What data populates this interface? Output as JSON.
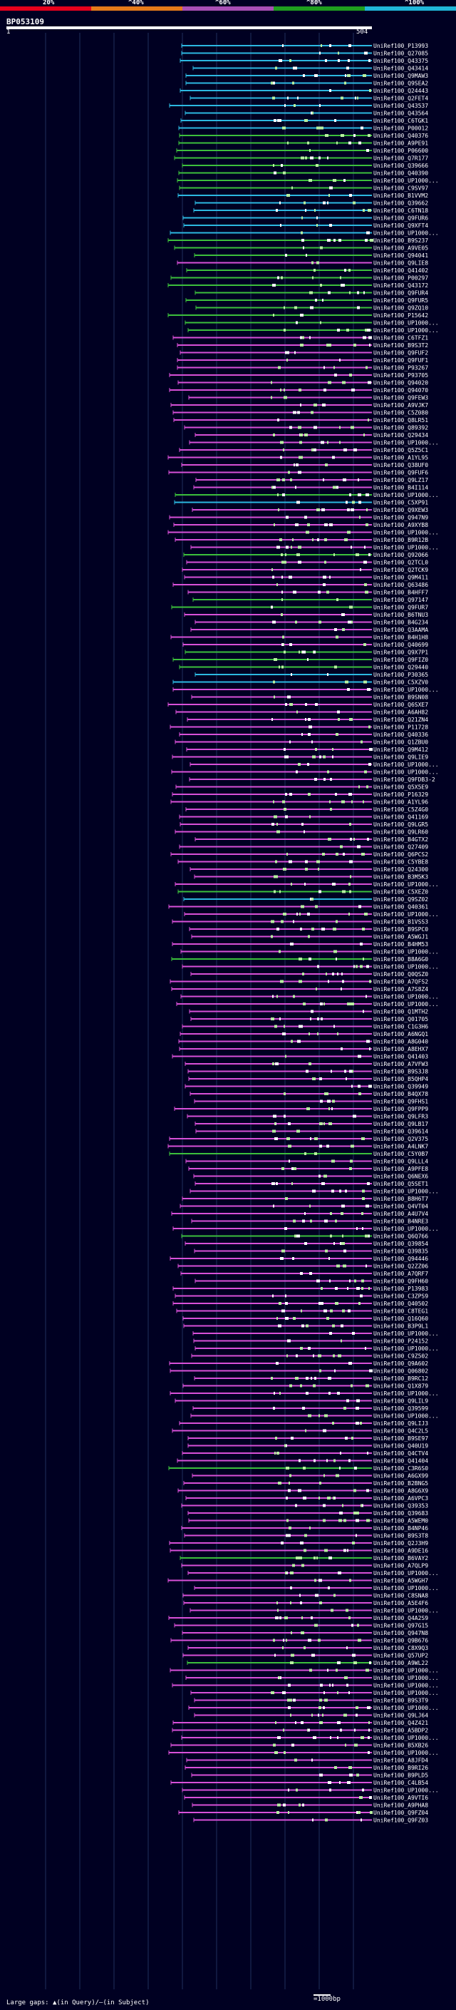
{
  "legend": {
    "labels": [
      "20%",
      "^40%",
      "^60%",
      "^80%",
      "^100%"
    ],
    "colors": [
      "#e8001c",
      "#e67a1a",
      "#a94fb5",
      "#1f9e1f",
      "#20b6d8"
    ]
  },
  "query": {
    "name": "BP053109",
    "start": "1",
    "end": "504"
  },
  "colors": {
    "background": "#000022",
    "grid": "#1f2f5c",
    "pink": "#d850d8",
    "green": "#3cbf3c",
    "cyan": "#2cb8e0",
    "light_green": "#b8f0a0",
    "white": "#ffffff"
  },
  "hits": [
    {
      "id": "UniRef100_P13993",
      "color": "cyan"
    },
    {
      "id": "UniRef100_Q27085",
      "color": "cyan"
    },
    {
      "id": "UniRef100_Q43375",
      "color": "cyan"
    },
    {
      "id": "UniRef100_Q43414",
      "color": "cyan"
    },
    {
      "id": "UniRef100_Q9MAW3",
      "color": "cyan"
    },
    {
      "id": "UniRef100_Q9SEA2",
      "color": "cyan"
    },
    {
      "id": "UniRef100_Q24443",
      "color": "cyan"
    },
    {
      "id": "UniRef100_Q2FET4",
      "color": "cyan"
    },
    {
      "id": "UniRef100_Q43537",
      "color": "cyan"
    },
    {
      "id": "UniRef100_Q43564",
      "color": "cyan"
    },
    {
      "id": "UniRef100_C6TGK1",
      "color": "cyan"
    },
    {
      "id": "UniRef100_P00012",
      "color": "cyan"
    },
    {
      "id": "UniRef100_Q40376",
      "color": "green"
    },
    {
      "id": "UniRef100_A9PE91",
      "color": "green"
    },
    {
      "id": "UniRef100_P06600",
      "color": "green"
    },
    {
      "id": "UniRef100_Q7R177",
      "color": "green"
    },
    {
      "id": "UniRef100_Q39666",
      "color": "green"
    },
    {
      "id": "UniRef100_Q40390",
      "color": "green"
    },
    {
      "id": "UniRef100_UP1000...",
      "color": "green"
    },
    {
      "id": "UniRef100_C9SV97",
      "color": "green"
    },
    {
      "id": "UniRef100_B1VVM2",
      "color": "cyan"
    },
    {
      "id": "UniRef100_Q39662",
      "color": "cyan"
    },
    {
      "id": "UniRef100_C6TN18",
      "color": "cyan"
    },
    {
      "id": "UniRef100_Q9FUR6",
      "color": "cyan"
    },
    {
      "id": "UniRef100_Q9XFT4",
      "color": "cyan"
    },
    {
      "id": "UniRef100_UP1000...",
      "color": "cyan"
    },
    {
      "id": "UniRef100_B9S237",
      "color": "green"
    },
    {
      "id": "UniRef100_A9VE05",
      "color": "green"
    },
    {
      "id": "UniRef100_Q94041",
      "color": "green"
    },
    {
      "id": "UniRef100_Q9LIE8",
      "color": "pink"
    },
    {
      "id": "UniRef100_Q41402",
      "color": "green"
    },
    {
      "id": "UniRef100_P00297",
      "color": "green"
    },
    {
      "id": "UniRef100_Q43172",
      "color": "green"
    },
    {
      "id": "UniRef100_Q9FUR4",
      "color": "green"
    },
    {
      "id": "UniRef100_Q9FUR5",
      "color": "green"
    },
    {
      "id": "UniRef100_Q9ZQ10",
      "color": "green"
    },
    {
      "id": "UniRef100_P15642",
      "color": "green"
    },
    {
      "id": "UniRef100_UP1000...",
      "color": "green"
    },
    {
      "id": "UniRef100_UP1000...",
      "color": "green"
    },
    {
      "id": "UniRef100_C6TFZ1",
      "color": "pink"
    },
    {
      "id": "UniRef100_B9S3T2",
      "color": "pink"
    },
    {
      "id": "UniRef100_Q9FUF2",
      "color": "pink"
    },
    {
      "id": "UniRef100_Q9FUF1",
      "color": "pink"
    },
    {
      "id": "UniRef100_P93267",
      "color": "pink"
    },
    {
      "id": "UniRef100_P93705",
      "color": "pink"
    },
    {
      "id": "UniRef100_Q94020",
      "color": "pink"
    },
    {
      "id": "UniRef100_Q94070",
      "color": "pink"
    },
    {
      "id": "UniRef100_Q9FEW3",
      "color": "pink"
    },
    {
      "id": "UniRef100_A9VJK7",
      "color": "pink"
    },
    {
      "id": "UniRef100_C5Z080",
      "color": "pink"
    },
    {
      "id": "UniRef100_Q8LR51",
      "color": "pink"
    },
    {
      "id": "UniRef100_Q89392",
      "color": "pink"
    },
    {
      "id": "UniRef100_Q29434",
      "color": "pink"
    },
    {
      "id": "UniRef100_UP1000...",
      "color": "pink"
    },
    {
      "id": "UniRef100_Q5Z5C1",
      "color": "pink"
    },
    {
      "id": "UniRef100_A1YL95",
      "color": "pink"
    },
    {
      "id": "UniRef100_Q38UF0",
      "color": "pink"
    },
    {
      "id": "UniRef100_Q9FUF6",
      "color": "pink"
    },
    {
      "id": "UniRef100_Q9LZ17",
      "color": "pink"
    },
    {
      "id": "UniRef100_B4I114",
      "color": "pink"
    },
    {
      "id": "UniRef100_UP1000...",
      "color": "green"
    },
    {
      "id": "UniRef100_C5XP91",
      "color": "cyan"
    },
    {
      "id": "UniRef100_Q9XEW3",
      "color": "pink"
    },
    {
      "id": "UniRef100_Q947N9",
      "color": "pink"
    },
    {
      "id": "UniRef100_A9XYB8",
      "color": "pink"
    },
    {
      "id": "UniRef100_UP1000...",
      "color": "pink"
    },
    {
      "id": "UniRef100_B9R12B",
      "color": "pink"
    },
    {
      "id": "UniRef100_UP1000...",
      "color": "pink"
    },
    {
      "id": "UniRef100_Q92066",
      "color": "green"
    },
    {
      "id": "UniRef100_Q2TCL0",
      "color": "pink"
    },
    {
      "id": "UniRef100_Q2TCK9",
      "color": "pink"
    },
    {
      "id": "UniRef100_Q9M411",
      "color": "pink"
    },
    {
      "id": "UniRef100_Q63486",
      "color": "pink"
    },
    {
      "id": "UniRef100_B4HFF7",
      "color": "pink"
    },
    {
      "id": "UniRef100_Q97147",
      "color": "green"
    },
    {
      "id": "UniRef100_Q9FUR7",
      "color": "green"
    },
    {
      "id": "UniRef100_B6TNU3",
      "color": "pink"
    },
    {
      "id": "UniRef100_B4G234",
      "color": "pink"
    },
    {
      "id": "UniRef100_Q3AAMA",
      "color": "pink"
    },
    {
      "id": "UniRef100_B4H1H8",
      "color": "pink"
    },
    {
      "id": "UniRef100_Q40699",
      "color": "pink"
    },
    {
      "id": "UniRef100_Q9X7P1",
      "color": "green"
    },
    {
      "id": "UniRef100_Q9FIZ0",
      "color": "green"
    },
    {
      "id": "UniRef100_Q29440",
      "color": "green"
    },
    {
      "id": "UniRef100_P30365",
      "color": "cyan"
    },
    {
      "id": "UniRef100_C5XZV0",
      "color": "cyan"
    },
    {
      "id": "UniRef100_UP1000...",
      "color": "pink"
    },
    {
      "id": "UniRef100_B9SN08",
      "color": "pink"
    },
    {
      "id": "UniRef100_Q6SXE7",
      "color": "pink"
    },
    {
      "id": "UniRef100_A6AH82",
      "color": "pink"
    },
    {
      "id": "UniRef100_Q21ZN4",
      "color": "pink"
    },
    {
      "id": "UniRef100_P11728",
      "color": "pink"
    },
    {
      "id": "UniRef100_Q40336",
      "color": "pink"
    },
    {
      "id": "UniRef100_Q1ZBU0",
      "color": "pink"
    },
    {
      "id": "UniRef100_Q9M412",
      "color": "pink"
    },
    {
      "id": "UniRef100_Q9LIE9",
      "color": "pink"
    },
    {
      "id": "UniRef100_UP1000...",
      "color": "pink"
    },
    {
      "id": "UniRef100_UP1000...",
      "color": "pink"
    },
    {
      "id": "UniRef100_Q9FDB3-2",
      "color": "pink"
    },
    {
      "id": "UniRef100_Q5X5E9",
      "color": "pink"
    },
    {
      "id": "UniRef100_P16329",
      "color": "pink"
    },
    {
      "id": "UniRef100_A1YL96",
      "color": "pink"
    },
    {
      "id": "UniRef100_C5Z4G0",
      "color": "pink"
    },
    {
      "id": "UniRef100_Q41169",
      "color": "pink"
    },
    {
      "id": "UniRef100_Q9LGR5",
      "color": "pink"
    },
    {
      "id": "UniRef100_Q9LR60",
      "color": "pink"
    },
    {
      "id": "UniRef100_B4GTX2",
      "color": "pink"
    },
    {
      "id": "UniRef100_Q27409",
      "color": "pink"
    },
    {
      "id": "UniRef100_Q6PCS2",
      "color": "pink"
    },
    {
      "id": "UniRef100_C5YBE8",
      "color": "pink"
    },
    {
      "id": "UniRef100_Q24300",
      "color": "pink"
    },
    {
      "id": "UniRef100_B3M5K3",
      "color": "pink"
    },
    {
      "id": "UniRef100_UP1000...",
      "color": "pink"
    },
    {
      "id": "UniRef100_C5XEZ0",
      "color": "green"
    },
    {
      "id": "UniRef100_Q9SZ02",
      "color": "cyan"
    },
    {
      "id": "UniRef100_Q40361",
      "color": "pink"
    },
    {
      "id": "UniRef100_UP1000...",
      "color": "pink"
    },
    {
      "id": "UniRef100_B1VSS3",
      "color": "pink"
    },
    {
      "id": "UniRef100_B9SPC0",
      "color": "pink"
    },
    {
      "id": "UniRef100_A5WGJ1",
      "color": "pink"
    },
    {
      "id": "UniRef100_B4HM53",
      "color": "pink"
    },
    {
      "id": "UniRef100_UP1000...",
      "color": "pink"
    },
    {
      "id": "UniRef100_B8A6G0",
      "color": "green"
    },
    {
      "id": "UniRef100_UP1000...",
      "color": "pink"
    },
    {
      "id": "UniRef100_Q0QSZ0",
      "color": "pink"
    },
    {
      "id": "UniRef100_A7QFS2",
      "color": "pink"
    },
    {
      "id": "UniRef100_A7S8Z4",
      "color": "pink"
    },
    {
      "id": "UniRef100_UP1000...",
      "color": "pink"
    },
    {
      "id": "UniRef100_UP1000...",
      "color": "pink"
    },
    {
      "id": "UniRef100_Q1MTH2",
      "color": "pink"
    },
    {
      "id": "UniRef100_Q01705",
      "color": "pink"
    },
    {
      "id": "UniRef100_C1G3H6",
      "color": "pink"
    },
    {
      "id": "UniRef100_A6NGQ1",
      "color": "pink"
    },
    {
      "id": "UniRef100_A8G040",
      "color": "pink"
    },
    {
      "id": "UniRef100_A8EHX7",
      "color": "pink"
    },
    {
      "id": "UniRef100_Q41403",
      "color": "pink"
    },
    {
      "id": "UniRef100_A7VFW3",
      "color": "pink"
    },
    {
      "id": "UniRef100_B9S3J8",
      "color": "pink"
    },
    {
      "id": "UniRef100_B5QHP4",
      "color": "pink"
    },
    {
      "id": "UniRef100_Q39949",
      "color": "pink"
    },
    {
      "id": "UniRef100_B4QX78",
      "color": "pink"
    },
    {
      "id": "UniRef100_Q9FHS1",
      "color": "pink"
    },
    {
      "id": "UniRef100_Q9FPP9",
      "color": "pink"
    },
    {
      "id": "UniRef100_Q9LFR3",
      "color": "pink"
    },
    {
      "id": "UniRef100_Q9LB17",
      "color": "pink"
    },
    {
      "id": "UniRef100_Q39614",
      "color": "pink"
    },
    {
      "id": "UniRef100_Q2V375",
      "color": "pink"
    },
    {
      "id": "UniRef100_A4LNK7",
      "color": "pink"
    },
    {
      "id": "UniRef100_C5Y0B7",
      "color": "green"
    },
    {
      "id": "UniRef100_Q9LLL4",
      "color": "pink"
    },
    {
      "id": "UniRef100_A9PFE8",
      "color": "pink"
    },
    {
      "id": "UniRef100_Q6NEX6",
      "color": "pink"
    },
    {
      "id": "UniRef100_Q5SET1",
      "color": "pink"
    },
    {
      "id": "UniRef100_UP1000...",
      "color": "pink"
    },
    {
      "id": "UniRef100_B8H6T7",
      "color": "pink"
    },
    {
      "id": "UniRef100_Q4VT04",
      "color": "pink"
    },
    {
      "id": "UniRef100_A4U7V4",
      "color": "pink"
    },
    {
      "id": "UniRef100_B4NRE3",
      "color": "pink"
    },
    {
      "id": "UniRef100_UP1000...",
      "color": "pink"
    },
    {
      "id": "UniRef100_Q6Q766",
      "color": "green"
    },
    {
      "id": "UniRef100_Q39854",
      "color": "pink"
    },
    {
      "id": "UniRef100_Q39835",
      "color": "pink"
    },
    {
      "id": "UniRef100_Q94446",
      "color": "pink"
    },
    {
      "id": "UniRef100_Q2ZZ06",
      "color": "pink"
    },
    {
      "id": "UniRef100_A7QRF7",
      "color": "pink"
    },
    {
      "id": "UniRef100_Q9FH60",
      "color": "pink"
    },
    {
      "id": "UniRef100_P13983",
      "color": "pink"
    },
    {
      "id": "UniRef100_C3ZPS9",
      "color": "pink"
    },
    {
      "id": "UniRef100_Q40502",
      "color": "pink"
    },
    {
      "id": "UniRef100_C8TEG1",
      "color": "pink"
    },
    {
      "id": "UniRef100_Q16Q60",
      "color": "pink"
    },
    {
      "id": "UniRef100_B3P9L1",
      "color": "pink"
    },
    {
      "id": "UniRef100_UP1000...",
      "color": "pink"
    },
    {
      "id": "UniRef100_P24152",
      "color": "pink"
    },
    {
      "id": "UniRef100_UP1000...",
      "color": "pink"
    },
    {
      "id": "UniRef100_C9Z502",
      "color": "pink"
    },
    {
      "id": "UniRef100_Q9A602",
      "color": "pink"
    },
    {
      "id": "UniRef100_Q06802",
      "color": "pink"
    },
    {
      "id": "UniRef100_B9RC12",
      "color": "pink"
    },
    {
      "id": "UniRef100_Q1X879",
      "color": "pink"
    },
    {
      "id": "UniRef100_UP1000...",
      "color": "pink"
    },
    {
      "id": "UniRef100_Q9LIL9",
      "color": "pink"
    },
    {
      "id": "UniRef100_Q39599",
      "color": "pink"
    },
    {
      "id": "UniRef100_UP1000...",
      "color": "pink"
    },
    {
      "id": "UniRef100_Q9LIJ3",
      "color": "pink"
    },
    {
      "id": "UniRef100_Q4C2L5",
      "color": "pink"
    },
    {
      "id": "UniRef100_B9SE97",
      "color": "pink"
    },
    {
      "id": "UniRef100_Q40U19",
      "color": "pink"
    },
    {
      "id": "UniRef100_Q4CTV4",
      "color": "pink"
    },
    {
      "id": "UniRef100_Q41404",
      "color": "pink"
    },
    {
      "id": "UniRef100_C3R6S0",
      "color": "green"
    },
    {
      "id": "UniRef100_A6GX99",
      "color": "pink"
    },
    {
      "id": "UniRef100_B2BNG5",
      "color": "pink"
    },
    {
      "id": "UniRef100_A8G6X9",
      "color": "pink"
    },
    {
      "id": "UniRef100_A6VPC3",
      "color": "pink"
    },
    {
      "id": "UniRef100_Q39353",
      "color": "pink"
    },
    {
      "id": "UniRef100_Q39683",
      "color": "pink"
    },
    {
      "id": "UniRef100_A5WEM0",
      "color": "pink"
    },
    {
      "id": "UniRef100_B4NP46",
      "color": "pink"
    },
    {
      "id": "UniRef100_B9S3T8",
      "color": "pink"
    },
    {
      "id": "UniRef100_Q2J3H9",
      "color": "pink"
    },
    {
      "id": "UniRef100_A9DE16",
      "color": "pink"
    },
    {
      "id": "UniRef100_B6VAY2",
      "color": "green"
    },
    {
      "id": "UniRef100_A7QLP9",
      "color": "pink"
    },
    {
      "id": "UniRef100_UP1000...",
      "color": "pink"
    },
    {
      "id": "UniRef100_A5WGH7",
      "color": "pink"
    },
    {
      "id": "UniRef100_UP1000...",
      "color": "pink"
    },
    {
      "id": "UniRef100_C8SNA8",
      "color": "pink"
    },
    {
      "id": "UniRef100_A5E4F6",
      "color": "pink"
    },
    {
      "id": "UniRef100_UP1000...",
      "color": "pink"
    },
    {
      "id": "UniRef100_Q4A2S9",
      "color": "pink"
    },
    {
      "id": "UniRef100_Q97G15",
      "color": "pink"
    },
    {
      "id": "UniRef100_Q947N8",
      "color": "pink"
    },
    {
      "id": "UniRef100_Q9B676",
      "color": "pink"
    },
    {
      "id": "UniRef100_C8X9Q3",
      "color": "pink"
    },
    {
      "id": "UniRef100_Q57UP2",
      "color": "pink"
    },
    {
      "id": "UniRef100_A9WL22",
      "color": "green"
    },
    {
      "id": "UniRef100_UP1000...",
      "color": "pink"
    },
    {
      "id": "UniRef100_UP1000...",
      "color": "pink"
    },
    {
      "id": "UniRef100_UP1000...",
      "color": "pink"
    },
    {
      "id": "UniRef100_UP1000...",
      "color": "pink"
    },
    {
      "id": "UniRef100_B9S3T9",
      "color": "pink"
    },
    {
      "id": "UniRef100_UP1000...",
      "color": "pink"
    },
    {
      "id": "UniRef100_Q9LJ64",
      "color": "pink"
    },
    {
      "id": "UniRef100_Q4Z421",
      "color": "pink"
    },
    {
      "id": "UniRef100_A5BDP2",
      "color": "pink"
    },
    {
      "id": "UniRef100_UP1000...",
      "color": "pink"
    },
    {
      "id": "UniRef100_B5XB26",
      "color": "pink"
    },
    {
      "id": "UniRef100_UP1000...",
      "color": "pink"
    },
    {
      "id": "UniRef100_A8JFD4",
      "color": "pink"
    },
    {
      "id": "UniRef100_B9RI26",
      "color": "pink"
    },
    {
      "id": "UniRef100_B9PLD5",
      "color": "pink"
    },
    {
      "id": "UniRef100_C4LB54",
      "color": "pink"
    },
    {
      "id": "UniRef100_UP1000...",
      "color": "pink"
    },
    {
      "id": "UniRef100_A9VTI6",
      "color": "pink"
    },
    {
      "id": "UniRef100_A9PHA8",
      "color": "pink"
    },
    {
      "id": "UniRef100_Q9FZ04",
      "color": "pink"
    },
    {
      "id": "UniRef100_Q9FZ03",
      "color": "pink"
    }
  ],
  "footer": {
    "text": "Large gaps: ▲(in Query)/—(in Subject)",
    "scale": "=1000bp"
  }
}
